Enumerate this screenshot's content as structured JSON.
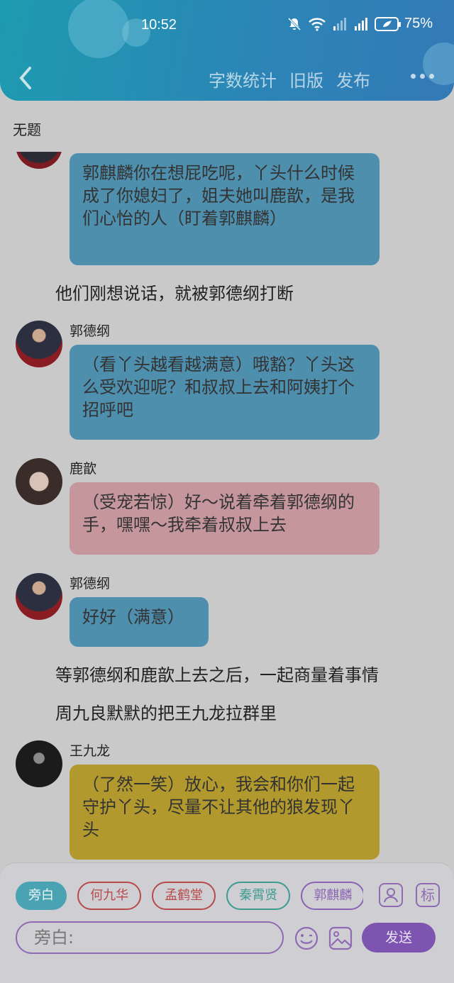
{
  "status_bar": {
    "time": "10:52",
    "battery": "75%"
  },
  "nav": {
    "actions": [
      "字数统计",
      "旧版",
      "发布"
    ]
  },
  "document": {
    "title": "无题"
  },
  "chat": {
    "msg_partial": "郭麒麟你在想屁吃呢，丫头什么时候成了你媳妇了，姐夫她叫鹿歆，是我们心怡的人（盯着郭麒麟）",
    "narr1": "他们刚想说话，就被郭德纲打断",
    "msg2_name": "郭德纲",
    "msg2_text": "（看丫头越看越满意）哦豁？丫头这么受欢迎呢？和叔叔上去和阿姨打个招呼吧",
    "msg3_name": "鹿歆",
    "msg3_text": "（受宠若惊）好～说着牵着郭德纲的手，嘿嘿～我牵着叔叔上去",
    "msg4_name": "郭德纲",
    "msg4_text": "好好（满意）",
    "narr2": "等郭德纲和鹿歆上去之后，一起商量着事情",
    "narr3": "周九良默默的把王九龙拉群里",
    "msg5_name": "王九龙",
    "msg5_text": "（了然一笑）放心，我会和你们一起守护丫头，尽量不让其他的狼发现丫头"
  },
  "roles": [
    "旁白",
    "何九华",
    "孟鹤堂",
    "秦霄贤",
    "郭麒麟"
  ],
  "composer": {
    "placeholder": "旁白:",
    "tag_icon_label": "标",
    "send_label": "发送"
  },
  "colors": {
    "header": "#2b86b6",
    "accent": "#7d55b1",
    "bubble_blue": "#4f8fae",
    "bubble_pink": "#c5979d",
    "bubble_yellow": "#b1992e"
  }
}
